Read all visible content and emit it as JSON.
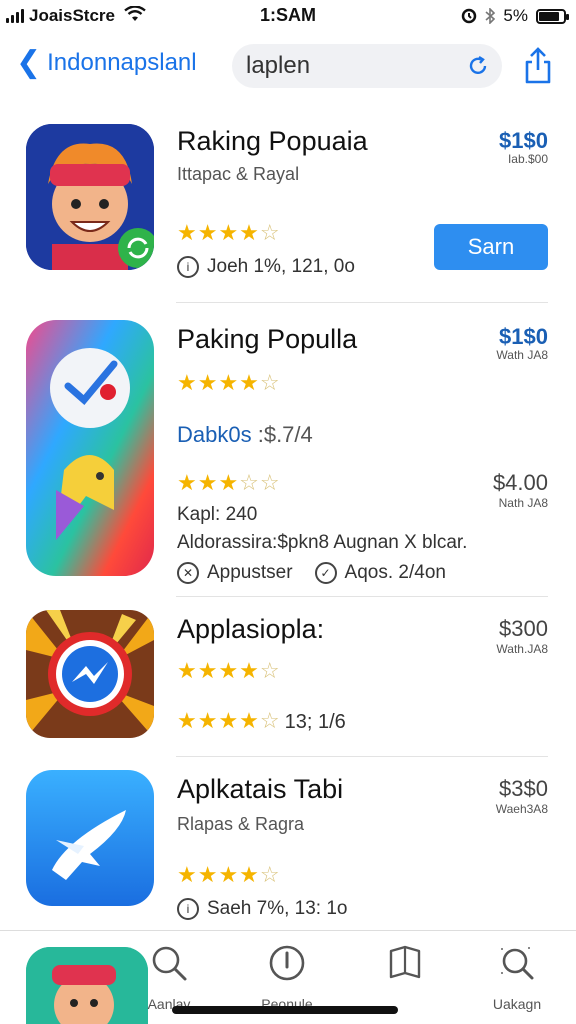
{
  "status_bar": {
    "carrier": "JoaisStcre",
    "time": "1:SAM",
    "battery": "5%",
    "battery_level": 0.85
  },
  "nav": {
    "back_label": "Indonnapslanl",
    "search_value": "laplen"
  },
  "apps": [
    {
      "title": "Raking Popuaia",
      "subtitle": "Ittapac & Rayal",
      "rating_stars": 4.5,
      "meta": "Joeh 1%, 121, 0o",
      "price": "$1$0",
      "price_note": "Iab.$00",
      "button_label": "Sarn"
    },
    {
      "title": "Paking Populla",
      "rating_stars": 4.5,
      "link_label": "Dabk0s",
      "link_rest": ":$.7/4",
      "rating_stars_2": 3.5,
      "sub_label": "Kapl: 240",
      "description": "Aldorassira:$pkn8 Augnan X blcar.",
      "meta_1": "Appustser",
      "meta_2": "Aqos. 2/4on",
      "price": "$1$0",
      "price_note": "Wath JA8",
      "price_2": "$4.00",
      "price_note_2": "Nath JA8"
    },
    {
      "title": "Applasiopla:",
      "rating_stars": 4.5,
      "rating_stars_2": 4.5,
      "rating_count": "13; 1/6",
      "price": "$300",
      "price_note": "Wath.JA8"
    },
    {
      "title": "Aplkatais Tabi",
      "subtitle": "Rlapas & Ragra",
      "rating_stars": 4.5,
      "meta": "Saeh 7%, 13: 1o",
      "price": "$3$0",
      "price_note": "Waeh3A8"
    }
  ],
  "tabbar": {
    "tabs": [
      {
        "label": "Aanlav",
        "icon": "search-icon"
      },
      {
        "label": "Peonule",
        "icon": "info-icon"
      },
      {
        "label": "",
        "icon": "book-icon"
      },
      {
        "label": "Uakagn",
        "icon": "magnifier-icon"
      }
    ]
  },
  "colors": {
    "accent": "#1a73e8",
    "button": "#2e8ef0",
    "star": "#f5b400"
  }
}
